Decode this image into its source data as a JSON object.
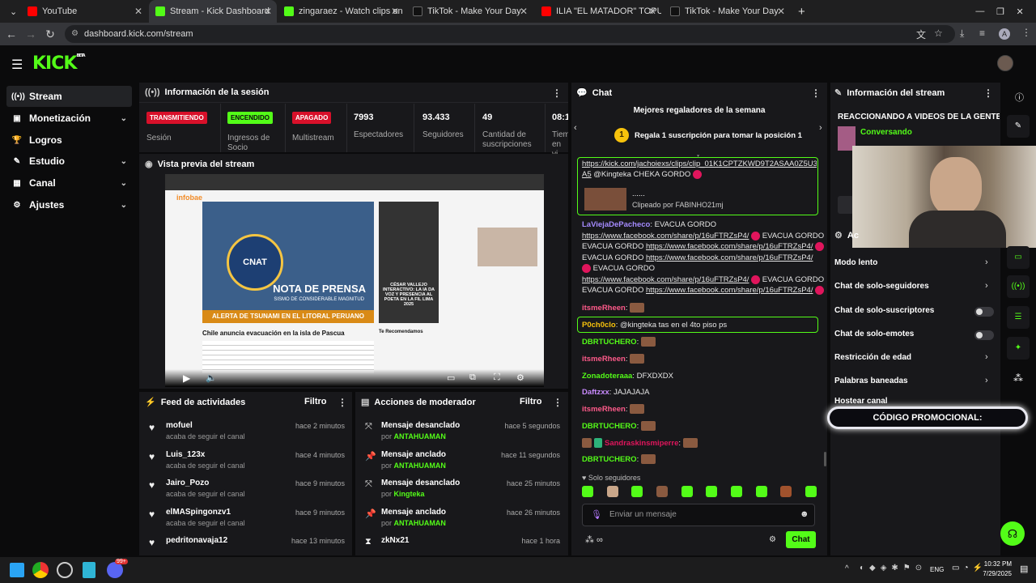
{
  "browser": {
    "tabs": [
      {
        "title": "YouTube",
        "color": "#ff0000"
      },
      {
        "title": "Stream - Kick Dashboard",
        "color": "#53fc18"
      },
      {
        "title": "zingaraez - Watch clips on Kick",
        "color": "#53fc18"
      },
      {
        "title": "TikTok - Make Your Day",
        "color": "#111111"
      },
      {
        "title": "ILIA \"EL MATADOR\" TOPURIA -",
        "color": "#ff0000"
      },
      {
        "title": "TikTok - Make Your Day",
        "color": "#111111"
      }
    ],
    "url": "dashboard.kick.com/stream",
    "profile_initial": "A"
  },
  "kick": {
    "logo": "KICK",
    "beta": "BETA"
  },
  "sidebar": [
    {
      "label": "Stream",
      "icon": "broadcast-icon"
    },
    {
      "label": "Monetización",
      "icon": "money-icon"
    },
    {
      "label": "Logros",
      "icon": "trophy-icon"
    },
    {
      "label": "Estudio",
      "icon": "studio-icon"
    },
    {
      "label": "Canal",
      "icon": "channel-icon"
    },
    {
      "label": "Ajustes",
      "icon": "gear-icon"
    }
  ],
  "session": {
    "title": "Información de la sesión",
    "stats": [
      {
        "badge": "TRANSMITIENDO",
        "label": "Sesión",
        "badge_color": "#d8102a"
      },
      {
        "badge": "ENCENDIDO",
        "label": "Ingresos de Socio",
        "badge_color": "#53fc18"
      },
      {
        "badge": "APAGADO",
        "label": "Multistream",
        "badge_color": "#d8102a"
      },
      {
        "value": "7993",
        "label": "Espectadores"
      },
      {
        "value": "93.433",
        "label": "Seguidores"
      },
      {
        "value": "49",
        "label": "Cantidad de suscripciones"
      },
      {
        "value": "08:1",
        "label": "Tiem en vi"
      }
    ]
  },
  "preview": {
    "title": "Vista previa del stream",
    "news": {
      "site": "infobae",
      "headline": "NOTA DE PRENSA",
      "subheadline": "SISMO DE CONSIDERABLE MAGNITUD",
      "banner": "ALERTA DE TSUNAMI EN EL LITORAL PERUANO",
      "article_title": "Chile anuncia evacuación en la isla de Pascua",
      "side_title": "CÉSAR VALLEJO INTERACTIVO: LA IA DA VOZ Y PRESENCIA AL POETA EN LA FIL LIMA 2025",
      "recommend": "Te Recomendamos",
      "seal": "CNAT"
    }
  },
  "feed": {
    "title": "Feed de actividades",
    "filter": "Filtro",
    "items": [
      {
        "name": "mofuel",
        "sub": "acaba de seguir el canal",
        "time": "hace 2 minutos"
      },
      {
        "name": "Luis_123x",
        "sub": "acaba de seguir el canal",
        "time": "hace 4 minutos"
      },
      {
        "name": "Jairo_Pozo",
        "sub": "acaba de seguir el canal",
        "time": "hace 9 minutos"
      },
      {
        "name": "elMASpingonzv1",
        "sub": "acaba de seguir el canal",
        "time": "hace 9 minutos"
      },
      {
        "name": "pedritonavaja12",
        "sub": "",
        "time": "hace 13 minutos"
      }
    ]
  },
  "mod": {
    "title": "Acciones de moderador",
    "filter": "Filtro",
    "items": [
      {
        "action": "Mensaje desanclado",
        "by": "por",
        "user": "ANTAHUAMAN",
        "time": "hace 5 segundos",
        "icon": "unpin-icon"
      },
      {
        "action": "Mensaje anclado",
        "by": "por",
        "user": "ANTAHUAMAN",
        "time": "hace 11 segundos",
        "icon": "pin-icon"
      },
      {
        "action": "Mensaje desanclado",
        "by": "por",
        "user": "Kingteka",
        "time": "hace 25 minutos",
        "icon": "unpin-icon"
      },
      {
        "action": "Mensaje anclado",
        "by": "por",
        "user": "ANTAHUAMAN",
        "time": "hace 26 minutos",
        "icon": "pin-icon"
      },
      {
        "action": "zkNx21",
        "by": "",
        "user": "",
        "time": "hace 1 hora",
        "icon": "hourglass-icon"
      }
    ]
  },
  "chat": {
    "title": "Chat",
    "top_gifters": "Mejores regaladores de la semana",
    "gift_cta": "Regala 1 suscripción para tomar la posición 1",
    "rank": "1",
    "pinned": {
      "link1": "https://kick.com/jachoiexs/clips/clip_01K1CPTZKWD9T2ASAA0Z5U3Q",
      "link2": "A5",
      "tail": "@Kingteka CHEKA GORDO",
      "clip_title": "......",
      "clip_by": "Clipeado por FABINHO21mj"
    },
    "fb_link": "https://www.facebook.com/share/p/16uFTRZsP4/",
    "lines": [
      {
        "user": "LaViejaDePacheco",
        "color": "#a58bff",
        "text": "EVACUA GORDO"
      },
      {
        "user": "itsmeRheen",
        "color": "#ff5a8a",
        "text": ""
      },
      {
        "user": "P0ch0clo",
        "color": "#f7c20c",
        "text": "@kingteka tas en el 4to piso ps"
      },
      {
        "user": "DBRTUCHERO",
        "color": "#53fc18",
        "text": ""
      },
      {
        "user": "itsmeRheen",
        "color": "#ff5a8a",
        "text": ""
      },
      {
        "user": "Zonadoteraaa",
        "color": "#53fc18",
        "text": "DFXDXDX"
      },
      {
        "user": "Daftzxx",
        "color": "#c98bff",
        "text": "JAJAJAJA"
      },
      {
        "user": "itsmeRheen",
        "color": "#ff5a8a",
        "text": ""
      },
      {
        "user": "DBRTUCHERO",
        "color": "#53fc18",
        "text": ""
      },
      {
        "user": "Sandraskinsmiperre",
        "color": "#e0155c",
        "text": ""
      },
      {
        "user": "DBRTUCHERO",
        "color": "#53fc18",
        "text": ""
      }
    ],
    "followers_only": "Solo seguidores",
    "input_placeholder": "Enviar un mensaje",
    "send": "Chat"
  },
  "stream_info": {
    "title": "Información del stream",
    "stream_title": "REACCIONANDO A VIDEOS DE LA GENTE",
    "category": "Conversando",
    "section_short": "Ac",
    "settings": [
      {
        "label": "Modo lento",
        "type": "chevron"
      },
      {
        "label": "Chat de solo-seguidores",
        "type": "chevron"
      },
      {
        "label": "Chat de solo-suscriptores",
        "type": "toggle"
      },
      {
        "label": "Chat de solo-emotes",
        "type": "toggle"
      },
      {
        "label": "Restricción de edad",
        "type": "chevron"
      },
      {
        "label": "Palabras baneadas",
        "type": "chevron"
      },
      {
        "label": "Hostear canal",
        "type": "none"
      }
    ],
    "promo": "CÓDIGO PROMOCIONAL:"
  },
  "taskbar": {
    "lang": "ENG",
    "time": "10:32 PM",
    "date": "7/29/2025",
    "badge": "99+"
  },
  "colors": {
    "accent": "#53fc18",
    "live": "#d8102a",
    "panel": "#18181b",
    "bg": "#0b0b0c"
  }
}
